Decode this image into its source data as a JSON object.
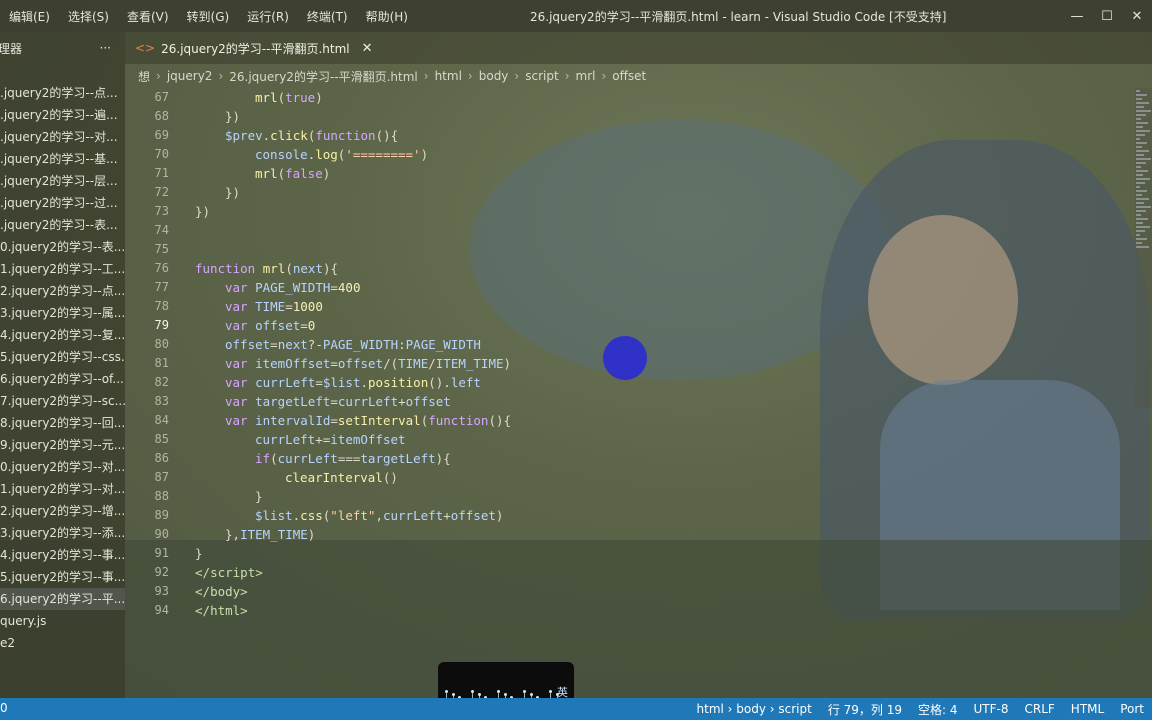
{
  "window": {
    "title": "26.jquery2的学习--平滑翻页.html - learn - Visual Studio Code [不受支持]",
    "menu": [
      "编辑(E)",
      "选择(S)",
      "查看(V)",
      "转到(G)",
      "运行(R)",
      "终端(T)",
      "帮助(H)"
    ],
    "controls": [
      "—",
      "☐",
      "✕"
    ]
  },
  "sidebar": {
    "title": "理器",
    "more": "···",
    "files": [
      ".jquery2的学习--点...",
      ".jquery2的学习--遍...",
      ".jquery2的学习--对...",
      ".jquery2的学习--基...",
      ".jquery2的学习--层...",
      ".jquery2的学习--过...",
      ".jquery2的学习--表...",
      "0.jquery2的学习--表...",
      "1.jquery2的学习--工...",
      "2.jquery2的学习--点...",
      "3.jquery2的学习--属...",
      "4.jquery2的学习--复...",
      "5.jquery2的学习--css...",
      "6.jquery2的学习--of...",
      "7.jquery2的学习--sc...",
      "8.jquery2的学习--回...",
      "9.jquery2的学习--元...",
      "0.jquery2的学习--对...",
      "1.jquery2的学习--对...",
      "2.jquery2的学习--增...",
      "3.jquery2的学习--添...",
      "4.jquery2的学习--事...",
      "5.jquery2的学习--事...",
      "6.jquery2的学习--平...",
      "query.js",
      "e2"
    ],
    "active_index": 23
  },
  "tab": {
    "icon": "<>",
    "label": "26.jquery2的学习--平滑翻页.html",
    "close": "✕"
  },
  "breadcrumb": [
    "想",
    "jquery2",
    "26.jquery2的学习--平滑翻页.html",
    "html",
    "body",
    "script",
    "mrl",
    "offset"
  ],
  "editor": {
    "current_line": 79,
    "lines": [
      {
        "n": 67,
        "indent": 4,
        "parts": [
          {
            "t": "mrl",
            "c": "fn"
          },
          {
            "t": "(",
            "c": ""
          },
          {
            "t": "true",
            "c": "kw"
          },
          {
            "t": ")",
            "c": ""
          }
        ]
      },
      {
        "n": 68,
        "indent": 2,
        "parts": [
          {
            "t": "})",
            "c": ""
          }
        ]
      },
      {
        "n": 69,
        "indent": 2,
        "parts": [
          {
            "t": "$prev",
            "c": "var"
          },
          {
            "t": ".",
            "c": ""
          },
          {
            "t": "click",
            "c": "fn"
          },
          {
            "t": "(",
            "c": ""
          },
          {
            "t": "function",
            "c": "kw"
          },
          {
            "t": "(){",
            "c": ""
          }
        ]
      },
      {
        "n": 70,
        "indent": 4,
        "parts": [
          {
            "t": "console",
            "c": "var"
          },
          {
            "t": ".",
            "c": ""
          },
          {
            "t": "log",
            "c": "fn"
          },
          {
            "t": "(",
            "c": ""
          },
          {
            "t": "'========'",
            "c": "str"
          },
          {
            "t": ")",
            "c": ""
          }
        ]
      },
      {
        "n": 71,
        "indent": 4,
        "parts": [
          {
            "t": "mrl",
            "c": "fn"
          },
          {
            "t": "(",
            "c": ""
          },
          {
            "t": "false",
            "c": "kw"
          },
          {
            "t": ")",
            "c": ""
          }
        ]
      },
      {
        "n": 72,
        "indent": 2,
        "parts": [
          {
            "t": "})",
            "c": ""
          }
        ]
      },
      {
        "n": 73,
        "indent": 0,
        "parts": [
          {
            "t": "})",
            "c": ""
          }
        ]
      },
      {
        "n": 74,
        "indent": 0,
        "parts": []
      },
      {
        "n": 75,
        "indent": 0,
        "parts": []
      },
      {
        "n": 76,
        "indent": 0,
        "parts": [
          {
            "t": "function ",
            "c": "kw"
          },
          {
            "t": "mrl",
            "c": "fn"
          },
          {
            "t": "(",
            "c": ""
          },
          {
            "t": "next",
            "c": "var"
          },
          {
            "t": "){",
            "c": ""
          }
        ]
      },
      {
        "n": 77,
        "indent": 2,
        "parts": [
          {
            "t": "var ",
            "c": "kw"
          },
          {
            "t": "PAGE_WIDTH",
            "c": "var"
          },
          {
            "t": "=",
            "c": ""
          },
          {
            "t": "400",
            "c": "num"
          }
        ]
      },
      {
        "n": 78,
        "indent": 2,
        "parts": [
          {
            "t": "var ",
            "c": "kw"
          },
          {
            "t": "TIME",
            "c": "var"
          },
          {
            "t": "=",
            "c": ""
          },
          {
            "t": "1000",
            "c": "num"
          }
        ]
      },
      {
        "n": 79,
        "indent": 2,
        "parts": [
          {
            "t": "var ",
            "c": "kw"
          },
          {
            "t": "offset",
            "c": "var"
          },
          {
            "t": "=",
            "c": ""
          },
          {
            "t": "0",
            "c": "num"
          }
        ]
      },
      {
        "n": 80,
        "indent": 2,
        "parts": [
          {
            "t": "offset",
            "c": "var"
          },
          {
            "t": "=",
            "c": ""
          },
          {
            "t": "next",
            "c": "var"
          },
          {
            "t": "?-",
            "c": ""
          },
          {
            "t": "PAGE_WIDTH",
            "c": "var"
          },
          {
            "t": ":",
            "c": ""
          },
          {
            "t": "PAGE_WIDTH",
            "c": "var"
          }
        ]
      },
      {
        "n": 81,
        "indent": 2,
        "parts": [
          {
            "t": "var ",
            "c": "kw"
          },
          {
            "t": "itemOffset",
            "c": "var"
          },
          {
            "t": "=",
            "c": ""
          },
          {
            "t": "offset",
            "c": "var"
          },
          {
            "t": "/(",
            "c": ""
          },
          {
            "t": "TIME",
            "c": "var"
          },
          {
            "t": "/",
            "c": ""
          },
          {
            "t": "ITEM_TIME",
            "c": "var"
          },
          {
            "t": ")",
            "c": ""
          }
        ]
      },
      {
        "n": 82,
        "indent": 2,
        "parts": [
          {
            "t": "var ",
            "c": "kw"
          },
          {
            "t": "currLeft",
            "c": "var"
          },
          {
            "t": "=",
            "c": ""
          },
          {
            "t": "$list",
            "c": "var"
          },
          {
            "t": ".",
            "c": ""
          },
          {
            "t": "position",
            "c": "fn"
          },
          {
            "t": "().",
            "c": ""
          },
          {
            "t": "left",
            "c": "prop"
          }
        ]
      },
      {
        "n": 83,
        "indent": 2,
        "parts": [
          {
            "t": "var ",
            "c": "kw"
          },
          {
            "t": "targetLeft",
            "c": "var"
          },
          {
            "t": "=",
            "c": ""
          },
          {
            "t": "currLeft",
            "c": "var"
          },
          {
            "t": "+",
            "c": ""
          },
          {
            "t": "offset",
            "c": "var"
          }
        ]
      },
      {
        "n": 84,
        "indent": 2,
        "parts": [
          {
            "t": "var ",
            "c": "kw"
          },
          {
            "t": "intervalId",
            "c": "var"
          },
          {
            "t": "=",
            "c": ""
          },
          {
            "t": "setInterval",
            "c": "fn"
          },
          {
            "t": "(",
            "c": ""
          },
          {
            "t": "function",
            "c": "kw"
          },
          {
            "t": "(){",
            "c": ""
          }
        ]
      },
      {
        "n": 85,
        "indent": 4,
        "parts": [
          {
            "t": "currLeft",
            "c": "var"
          },
          {
            "t": "+=",
            "c": ""
          },
          {
            "t": "itemOffset",
            "c": "var"
          }
        ]
      },
      {
        "n": 86,
        "indent": 4,
        "parts": [
          {
            "t": "if",
            "c": "kw"
          },
          {
            "t": "(",
            "c": ""
          },
          {
            "t": "currLeft",
            "c": "var"
          },
          {
            "t": "===",
            "c": ""
          },
          {
            "t": "targetLeft",
            "c": "var"
          },
          {
            "t": "){",
            "c": ""
          }
        ]
      },
      {
        "n": 87,
        "indent": 6,
        "parts": [
          {
            "t": "clearInterval",
            "c": "fn"
          },
          {
            "t": "()",
            "c": ""
          }
        ]
      },
      {
        "n": 88,
        "indent": 4,
        "parts": [
          {
            "t": "}",
            "c": ""
          }
        ]
      },
      {
        "n": 89,
        "indent": 4,
        "parts": [
          {
            "t": "$list",
            "c": "var"
          },
          {
            "t": ".",
            "c": ""
          },
          {
            "t": "css",
            "c": "fn"
          },
          {
            "t": "(",
            "c": ""
          },
          {
            "t": "\"left\"",
            "c": "str"
          },
          {
            "t": ",",
            "c": ""
          },
          {
            "t": "currLeft",
            "c": "var"
          },
          {
            "t": "+",
            "c": ""
          },
          {
            "t": "offset",
            "c": "var"
          },
          {
            "t": ")",
            "c": ""
          }
        ]
      },
      {
        "n": 90,
        "indent": 2,
        "parts": [
          {
            "t": "},",
            "c": ""
          },
          {
            "t": "ITEM_TIME",
            "c": "var"
          },
          {
            "t": ")",
            "c": ""
          }
        ]
      },
      {
        "n": 91,
        "indent": 0,
        "parts": [
          {
            "t": "}",
            "c": ""
          }
        ]
      },
      {
        "n": 92,
        "indent": -1,
        "parts": [
          {
            "t": "</",
            "c": "tag"
          },
          {
            "t": "script",
            "c": "tag"
          },
          {
            "t": ">",
            "c": "tag"
          }
        ]
      },
      {
        "n": 93,
        "indent": -1,
        "parts": [
          {
            "t": "</",
            "c": "tag"
          },
          {
            "t": "body",
            "c": "tag"
          },
          {
            "t": ">",
            "c": "tag"
          }
        ]
      },
      {
        "n": 94,
        "indent": -1,
        "parts": [
          {
            "t": "</",
            "c": "tag"
          },
          {
            "t": "html",
            "c": "tag"
          },
          {
            "t": ">",
            "c": "tag"
          }
        ]
      }
    ]
  },
  "status": {
    "left": "0",
    "path": "html › body › script",
    "position": "行 79，列 19",
    "spaces": "空格: 4",
    "encoding": "UTF-8",
    "eol": "CRLF",
    "language": "HTML",
    "port": "Port"
  },
  "widget": {
    "glyph": "英"
  },
  "colors": {
    "status_bar": "#1f78b8",
    "cursor_highlight": "#2727d8",
    "tab_icon": "#e8804f"
  }
}
